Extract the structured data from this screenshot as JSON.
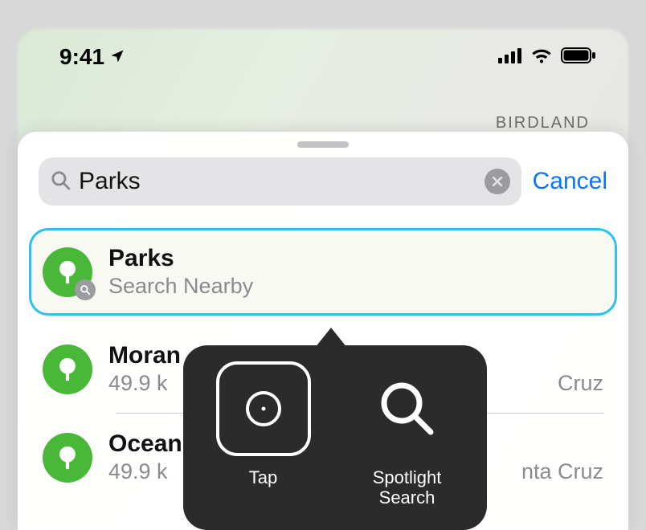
{
  "status_bar": {
    "time": "9:41"
  },
  "map": {
    "district_label": "BIRDLAND"
  },
  "search": {
    "query": "Parks",
    "cancel_label": "Cancel"
  },
  "results": [
    {
      "name": "Parks",
      "subtitle": "Search Nearby",
      "focused": true,
      "has_search_badge": true
    },
    {
      "name": "Moran",
      "subtitle_left": "49.9 k",
      "subtitle_right": "Cruz"
    },
    {
      "name": "Ocean",
      "subtitle_left": "49.9 k",
      "subtitle_right": "nta Cruz"
    }
  ],
  "popover": {
    "items": [
      {
        "label": "Tap",
        "icon": "tap"
      },
      {
        "label": "Spotlight\nSearch",
        "icon": "search"
      }
    ]
  }
}
